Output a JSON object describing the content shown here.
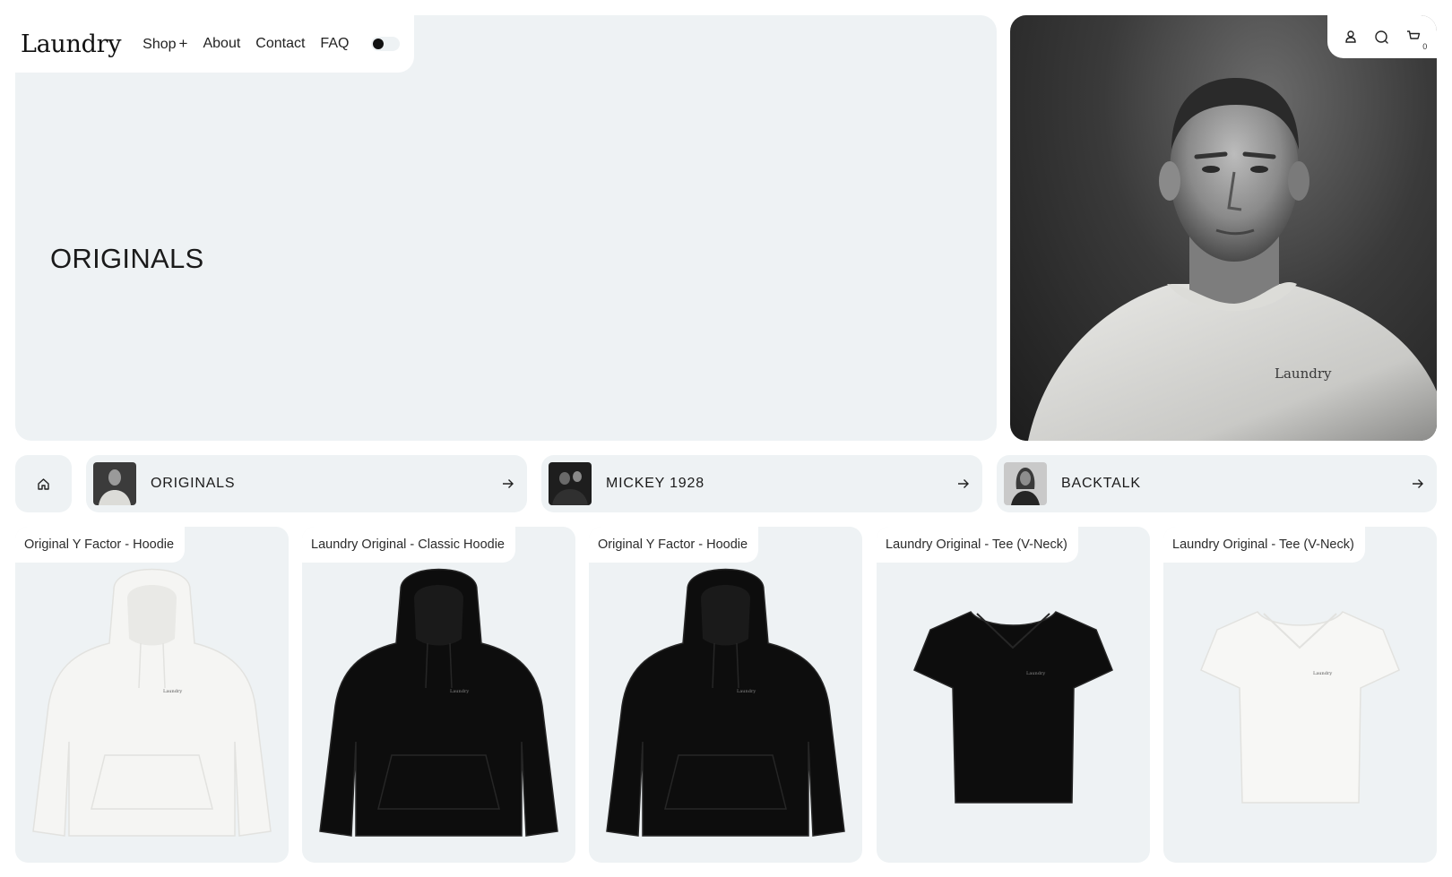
{
  "header": {
    "logo": "Laundry",
    "nav": [
      {
        "label": "Shop",
        "suffix": "+"
      },
      {
        "label": "About"
      },
      {
        "label": "Contact"
      },
      {
        "label": "FAQ"
      }
    ],
    "theme_toggle": "dark-mode-toggle",
    "icons": [
      "account-icon",
      "search-icon",
      "cart-icon"
    ],
    "cart_count": "0"
  },
  "hero": {
    "title": "ORIGINALS",
    "image": "black-and-white portrait of man in white tee",
    "image_shirt_text": "Laundry"
  },
  "categories": [
    {
      "label": "ORIGINALS"
    },
    {
      "label": "MICKEY 1928"
    },
    {
      "label": "BACKTALK"
    }
  ],
  "products": [
    {
      "name": "Original Y Factor - Hoodie",
      "color": "#f5f5f3",
      "type": "hoodie"
    },
    {
      "name": "Laundry Original - Classic Hoodie",
      "color": "#0d0d0d",
      "type": "hoodie"
    },
    {
      "name": "Original Y Factor - Hoodie",
      "color": "#0d0d0d",
      "type": "hoodie"
    },
    {
      "name": "Laundry Original - Tee (V-Neck)",
      "color": "#0d0d0d",
      "type": "tee"
    },
    {
      "name": "Laundry Original - Tee (V-Neck)",
      "color": "#f7f7f5",
      "type": "tee"
    }
  ],
  "garment_print": "Laundry",
  "colors": {
    "panel": "#eef2f4",
    "background": "#ffffff",
    "text": "#1b1b1b"
  }
}
